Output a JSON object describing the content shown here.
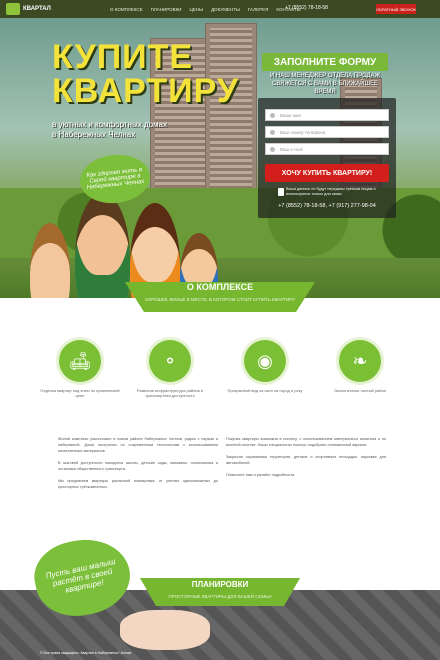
{
  "header": {
    "logo_title": "КВАРТАЛ",
    "logo_subtitle": "КВАРТАЛ",
    "nav": [
      "О КОМПЛЕКСЕ",
      "ПЛАНИРОВКИ",
      "ЦЕНЫ",
      "ДОКУМЕНТЫ",
      "ГАЛЕРЕЯ",
      "КОНТАКТЫ"
    ],
    "phone": "+7 (8552) 78-18-58",
    "callback": "ОБРАТНЫЙ ЗВОНОК"
  },
  "hero": {
    "title_line1": "КУПИТЕ",
    "title_line2": "КВАРТИРУ",
    "subtitle": "в уютных и комфортных домах в Набережных Челнах",
    "cloud_text": "Как здорово жить в Своей квартире в Набережных Челнах"
  },
  "form": {
    "heading": "ЗАПОЛНИТЕ ФОРМУ",
    "subheading": "И НАШ МЕНЕДЖЕР ОТДЕЛА ПРОДАЖ СВЯЖЕТСЯ С ВАМИ В БЛИЖАЙШЕЕ ВРЕМЯ",
    "name_placeholder": "Ваше имя",
    "phone_placeholder": "Ваш номер телефона",
    "email_placeholder": "Ваш e-mail",
    "submit": "ХОЧУ КУПИТЬ КВАРТИРУ!",
    "privacy_note": "Ваши данные не будут переданы третьим лицам и используются только для связи",
    "phones": "+7 (8552) 78-18-58, +7 (917) 277-98-04"
  },
  "about": {
    "title": "О КОМПЛЕКСЕ",
    "subtitle": "ХОРОШЕЕ ЖИЛЬЁ В МЕСТЕ, В КОТОРОМ СТОИТ КУПИТЬ КВАРТИРУ",
    "features": [
      {
        "icon": "sofa-icon",
        "glyph": "🛋",
        "text": "Отделка квартир под ключ по приемлемой цене"
      },
      {
        "icon": "network-icon",
        "glyph": "⚬",
        "text": "Развитая инфраструктура района и транспортная доступность"
      },
      {
        "icon": "binoculars-icon",
        "glyph": "◉",
        "text": "Прекрасный вид из окон на город и реку"
      },
      {
        "icon": "leaf-icon",
        "glyph": "❧",
        "text": "Экологически чистый район"
      }
    ],
    "left_col": [
      "Жилой комплекс расположен в новом районе Набережных Челнов, рядом с парком и набережной. Дома построены по современным технологиям с использованием качественных материалов.",
      "В шаговой доступности находятся школы, детские сады, магазины, поликлиника и остановки общественного транспорта.",
      "Мы предлагаем квартиры различной планировки: от уютных однокомнатных до просторных трёхкомнатных."
    ],
    "right_col": [
      "Покупка квартиры возможна в ипотеку, с использованием материнского капитала и по военной ипотеке. Наши специалисты помогут подобрать оптимальный вариант.",
      "Закрытая охраняемая территория, детские и спортивные площадки, парковка для автомобилей.",
      "Позвоните нам и узнайте подробности."
    ]
  },
  "plans": {
    "title": "ПЛАНИРОВКИ",
    "subtitle": "ПРОСТОРНЫЕ КВАРТИРЫ ДЛЯ ВАШЕЙ СЕМЬИ",
    "cloud_text": "Пусть ваш малыш растёт в своей квартире!",
    "footer": "© Все права защищены. Квартал в Набережных Челнах"
  }
}
